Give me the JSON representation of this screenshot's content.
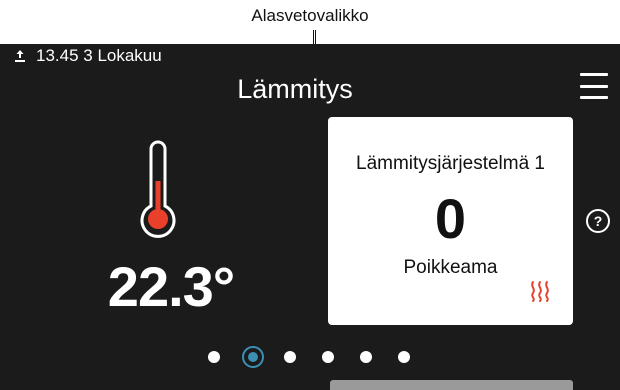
{
  "annotation": {
    "label": "Alasvetovalikko"
  },
  "status_bar": {
    "icon": "usb-icon",
    "datetime": "13.45 3 Lokakuu"
  },
  "header": {
    "title": "Lämmitys",
    "menu_icon": "hamburger-menu-icon"
  },
  "temperature": {
    "icon": "thermometer-icon",
    "value": "22.3°",
    "fill_fraction": 0.55,
    "accent_color": "#e8402a"
  },
  "card": {
    "title": "Lämmitysjärjestelmä 1",
    "value": "0",
    "label": "Poikkeama",
    "icon": "heat-waves-icon",
    "icon_color": "#e8402a"
  },
  "help": {
    "icon": "question-mark-icon",
    "label": "?"
  },
  "pagination": {
    "count": 6,
    "active_index": 1,
    "active_color": "#3a8fb5"
  },
  "colors": {
    "screen_background": "#1b1b1b",
    "text": "#ffffff",
    "card_background": "#ffffff"
  }
}
